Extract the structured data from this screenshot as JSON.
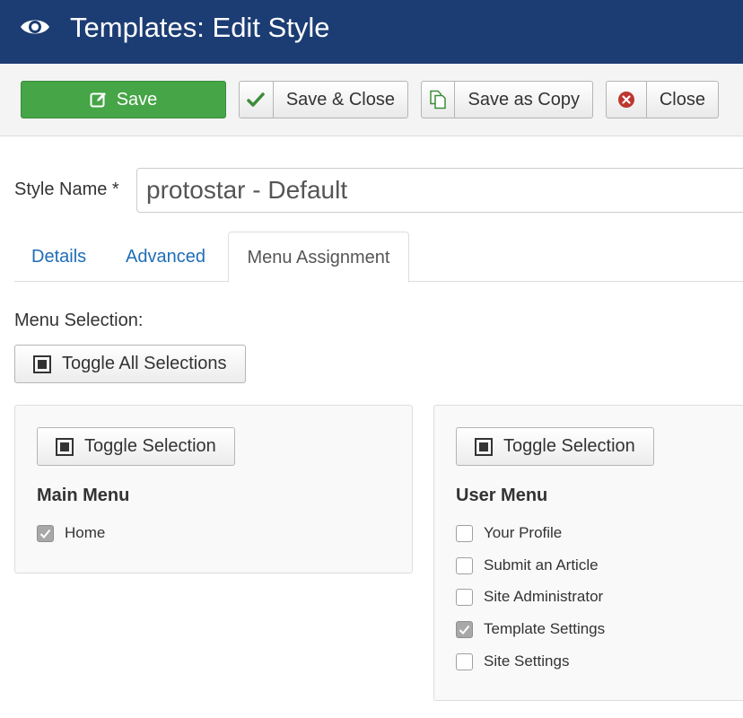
{
  "header": {
    "title": "Templates: Edit Style",
    "icon": "eye-icon",
    "bg_color": "#1c3d73"
  },
  "toolbar": {
    "save_label": "Save",
    "save_close_label": "Save & Close",
    "save_copy_label": "Save as Copy",
    "close_label": "Close",
    "save_color": "#46a546",
    "check_color": "#3a8d3a",
    "close_icon_color": "#bd362f"
  },
  "form": {
    "style_name_label": "Style Name *",
    "style_name_value": "protostar - Default"
  },
  "tabs": [
    {
      "label": "Details",
      "active": false
    },
    {
      "label": "Advanced",
      "active": false
    },
    {
      "label": "Menu Assignment",
      "active": true
    }
  ],
  "menu_assignment": {
    "menu_selection_label": "Menu Selection:",
    "toggle_all_label": "Toggle All Selections",
    "toggle_selection_label": "Toggle Selection",
    "menus": [
      {
        "title": "Main Menu",
        "items": [
          {
            "label": "Home",
            "checked": true
          }
        ]
      },
      {
        "title": "User Menu",
        "items": [
          {
            "label": "Your Profile",
            "checked": false
          },
          {
            "label": "Submit an Article",
            "checked": false
          },
          {
            "label": "Site Administrator",
            "checked": false
          },
          {
            "label": "Template Settings",
            "checked": true
          },
          {
            "label": "Site Settings",
            "checked": false
          }
        ]
      }
    ]
  }
}
